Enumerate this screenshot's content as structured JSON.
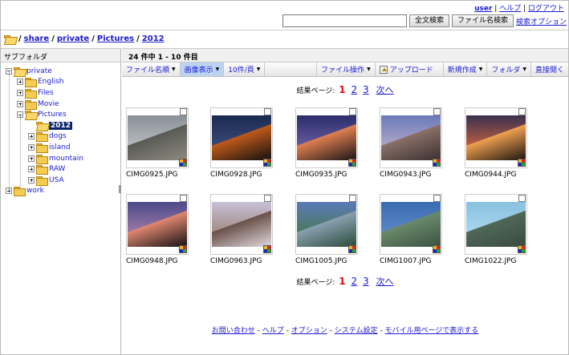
{
  "header": {
    "user_link": "user",
    "help_link": "ヘルプ",
    "logout_link": "ログアウト",
    "search_placeholder": "",
    "fulltext_button": "全文検索",
    "filename_button": "ファイル名検索",
    "search_options_link": "検索オプション"
  },
  "breadcrumb": {
    "root": "/",
    "items": [
      "share",
      "private",
      "Pictures",
      "2012"
    ]
  },
  "sidebar": {
    "title": "サブフォルダ",
    "tree": [
      {
        "label": "private",
        "level": 0,
        "toggle": "minus"
      },
      {
        "label": "English",
        "level": 1,
        "toggle": "plus"
      },
      {
        "label": "Files",
        "level": 1,
        "toggle": "plus"
      },
      {
        "label": "Movie",
        "level": 1,
        "toggle": "plus"
      },
      {
        "label": "Pictures",
        "level": 1,
        "toggle": "minus"
      },
      {
        "label": "2012",
        "level": 2,
        "toggle": "none",
        "selected": true
      },
      {
        "label": "dogs",
        "level": 2,
        "toggle": "plus"
      },
      {
        "label": "island",
        "level": 2,
        "toggle": "plus"
      },
      {
        "label": "mountain",
        "level": 2,
        "toggle": "plus"
      },
      {
        "label": "RAW",
        "level": 2,
        "toggle": "plus"
      },
      {
        "label": "USA",
        "level": 2,
        "toggle": "plus"
      },
      {
        "label": "work",
        "level": 0,
        "toggle": "plus"
      }
    ]
  },
  "main": {
    "count_text": "24 件中 1 - 10 件目",
    "toolbar": {
      "sort": "ファイル名順",
      "view": "画像表示",
      "per_page": "10件/頁",
      "file_ops": "ファイル操作",
      "upload": "アップロード",
      "new": "新規作成",
      "folder": "フォルダ",
      "open_direct": "直接開く"
    },
    "pager": {
      "label": "結果ページ:",
      "current": "1",
      "pages": [
        "2",
        "3"
      ],
      "next": "次へ"
    },
    "files": [
      {
        "name": "CIMG0925.JPG",
        "colors": [
          "#8a9098",
          "#b8bcc0",
          "#5a5a55",
          "#8c8a80"
        ]
      },
      {
        "name": "CIMG0928.JPG",
        "colors": [
          "#1a2a50",
          "#3a4a78",
          "#c05a1a",
          "#101010"
        ]
      },
      {
        "name": "CIMG0935.JPG",
        "colors": [
          "#2a2e6a",
          "#6a5aa0",
          "#e08050",
          "#1a1418"
        ]
      },
      {
        "name": "CIMG0943.JPG",
        "colors": [
          "#6a7ab8",
          "#b0a8c8",
          "#8a7068",
          "#3a3030"
        ]
      },
      {
        "name": "CIMG0944.JPG",
        "colors": [
          "#3a3050",
          "#c06040",
          "#f0a050",
          "#1a1410"
        ]
      },
      {
        "name": "CIMG0948.JPG",
        "colors": [
          "#4a4a88",
          "#a07aa8",
          "#e08870",
          "#141014"
        ]
      },
      {
        "name": "CIMG0963.JPG",
        "colors": [
          "#c8c0d8",
          "#a08a80",
          "#6a5048",
          "#e0d8e0"
        ]
      },
      {
        "name": "CIMG1005.JPG",
        "colors": [
          "#5a7ab8",
          "#4a7a5a",
          "#8aa0b0",
          "#2a4a3a"
        ]
      },
      {
        "name": "CIMG1007.JPG",
        "colors": [
          "#3a6ab0",
          "#5a88c8",
          "#6a8a6a",
          "#3a5040"
        ]
      },
      {
        "name": "CIMG1022.JPG",
        "colors": [
          "#8ac0e0",
          "#a8d8ec",
          "#506858",
          "#3a4a40"
        ]
      }
    ]
  },
  "footer": {
    "links": [
      "お問い合わせ",
      "ヘルプ",
      "オプション",
      "システム設定",
      "モバイル用ページで表示する"
    ],
    "separator": " - "
  }
}
